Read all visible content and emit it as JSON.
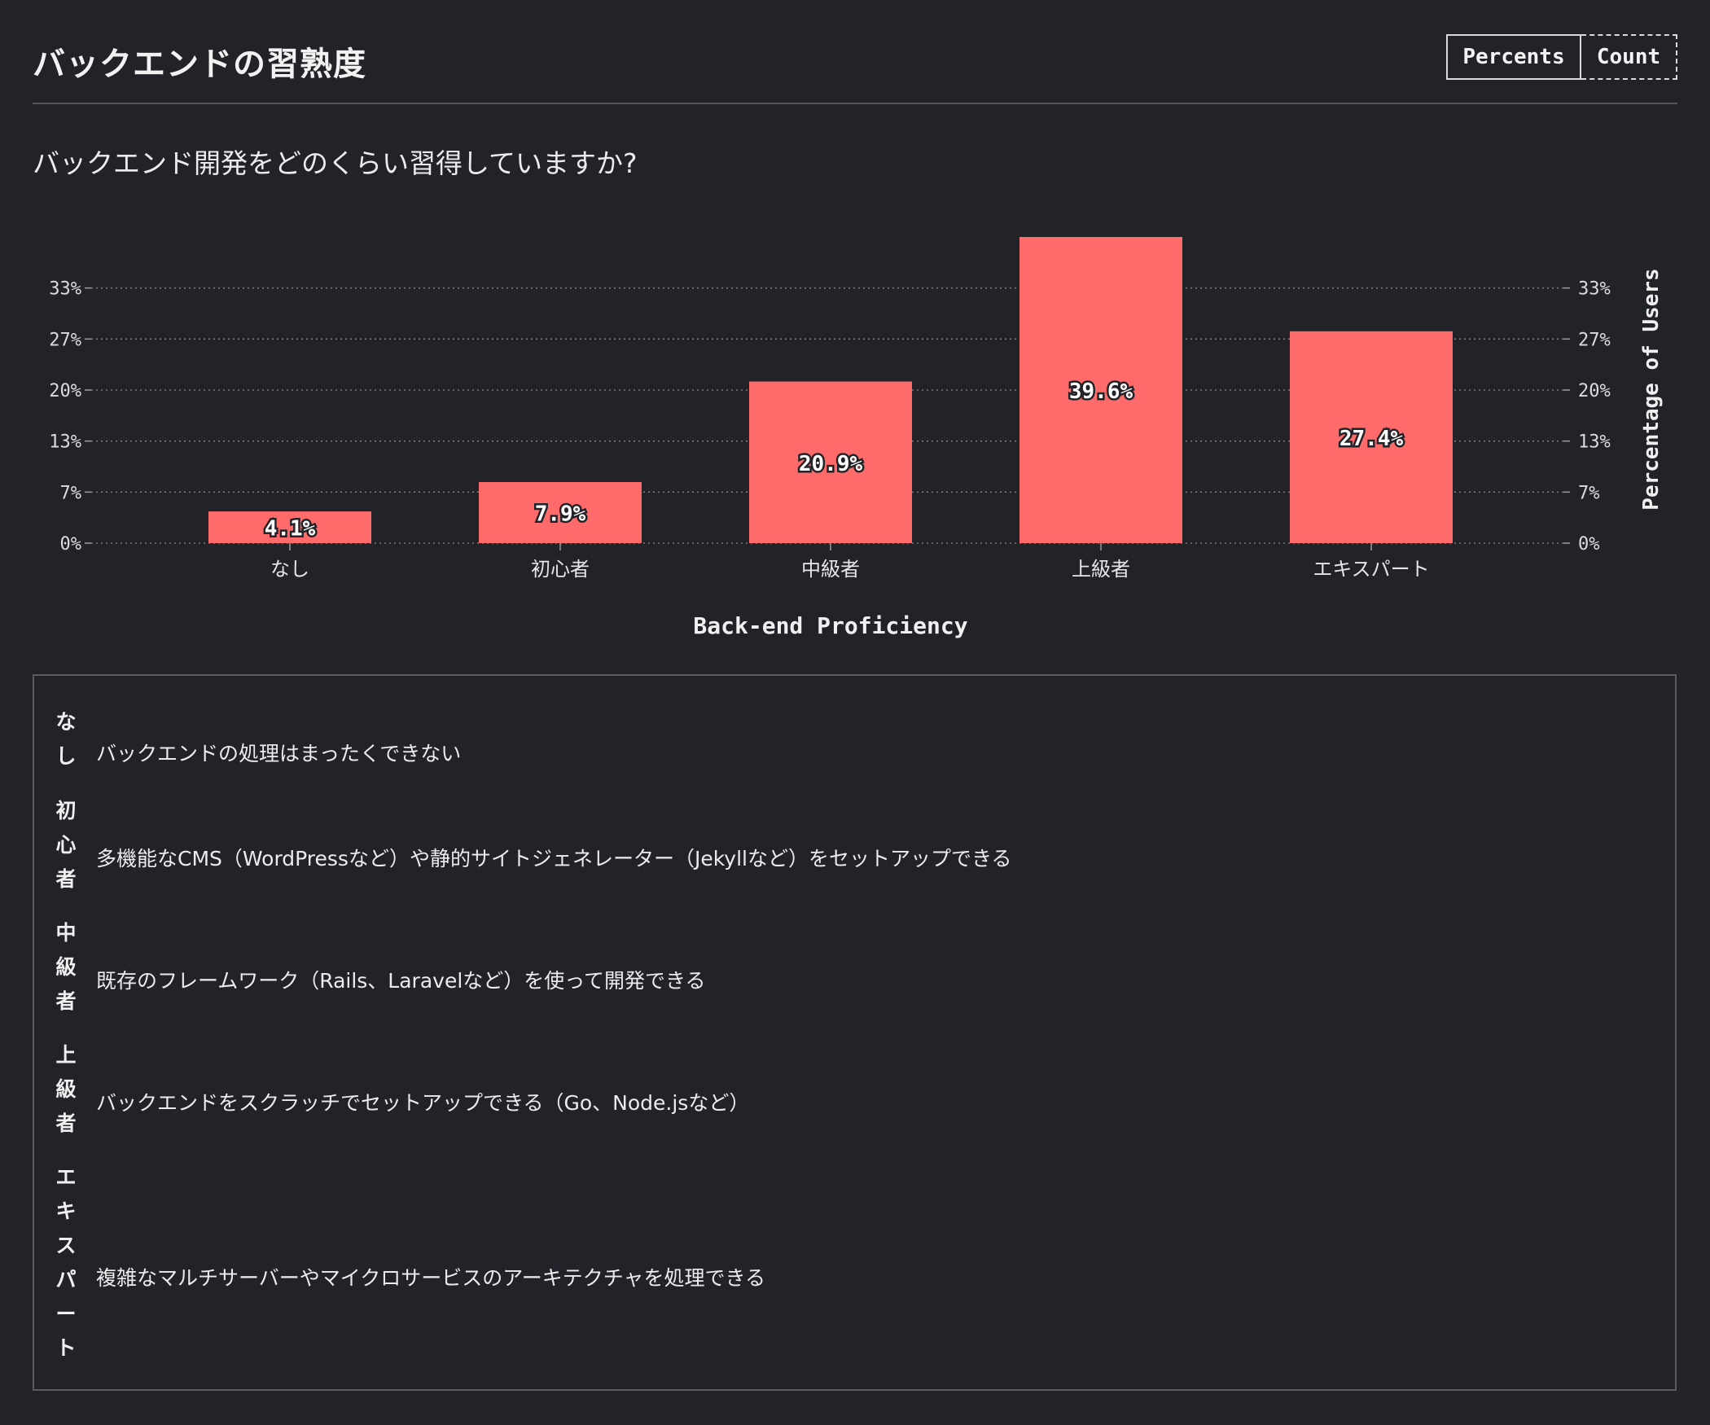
{
  "header": {
    "title": "バックエンドの習熟度",
    "toggle": {
      "percents_label": "Percents",
      "count_label": "Count",
      "selected": "Percents"
    }
  },
  "question": "バックエンド開発をどのくらい習得していますか?",
  "chart_data": {
    "type": "bar",
    "categories": [
      "なし",
      "初心者",
      "中級者",
      "上級者",
      "エキスパート"
    ],
    "values": [
      4.1,
      7.9,
      20.9,
      39.6,
      27.4
    ],
    "value_labels": [
      "4.1%",
      "7.9%",
      "20.9%",
      "39.6%",
      "27.4%"
    ],
    "xlabel": "Back-end Proficiency",
    "ylabel": "Percentage of Users",
    "yticks": [
      0,
      6.6,
      13.2,
      19.8,
      26.4,
      33.0
    ],
    "ytick_labels": [
      "0%",
      "7%",
      "13%",
      "20%",
      "27%",
      "33%"
    ],
    "ylim": [
      0,
      39.6
    ],
    "grid": true,
    "bar_color": "#ff6b6b"
  },
  "legend": [
    {
      "term": "なし",
      "description": "バックエンドの処理はまったくできない"
    },
    {
      "term": "初心者",
      "description": "多機能なCMS（WordPressなど）や静的サイトジェネレーター（Jekyllなど）をセットアップできる"
    },
    {
      "term": "中級者",
      "description": "既存のフレームワーク（Rails、Laravelなど）を使って開発できる"
    },
    {
      "term": "上級者",
      "description": "バックエンドをスクラッチでセットアップできる（Go、Node.jsなど）"
    },
    {
      "term": "エキスパート",
      "description": "複雑なマルチサーバーやマイクロサービスのアーキテクチャを処理できる"
    }
  ],
  "colors": {
    "background": "#222328",
    "text": "#eaeaea",
    "grid": "#777a80",
    "bar": "#ff6b6b"
  }
}
